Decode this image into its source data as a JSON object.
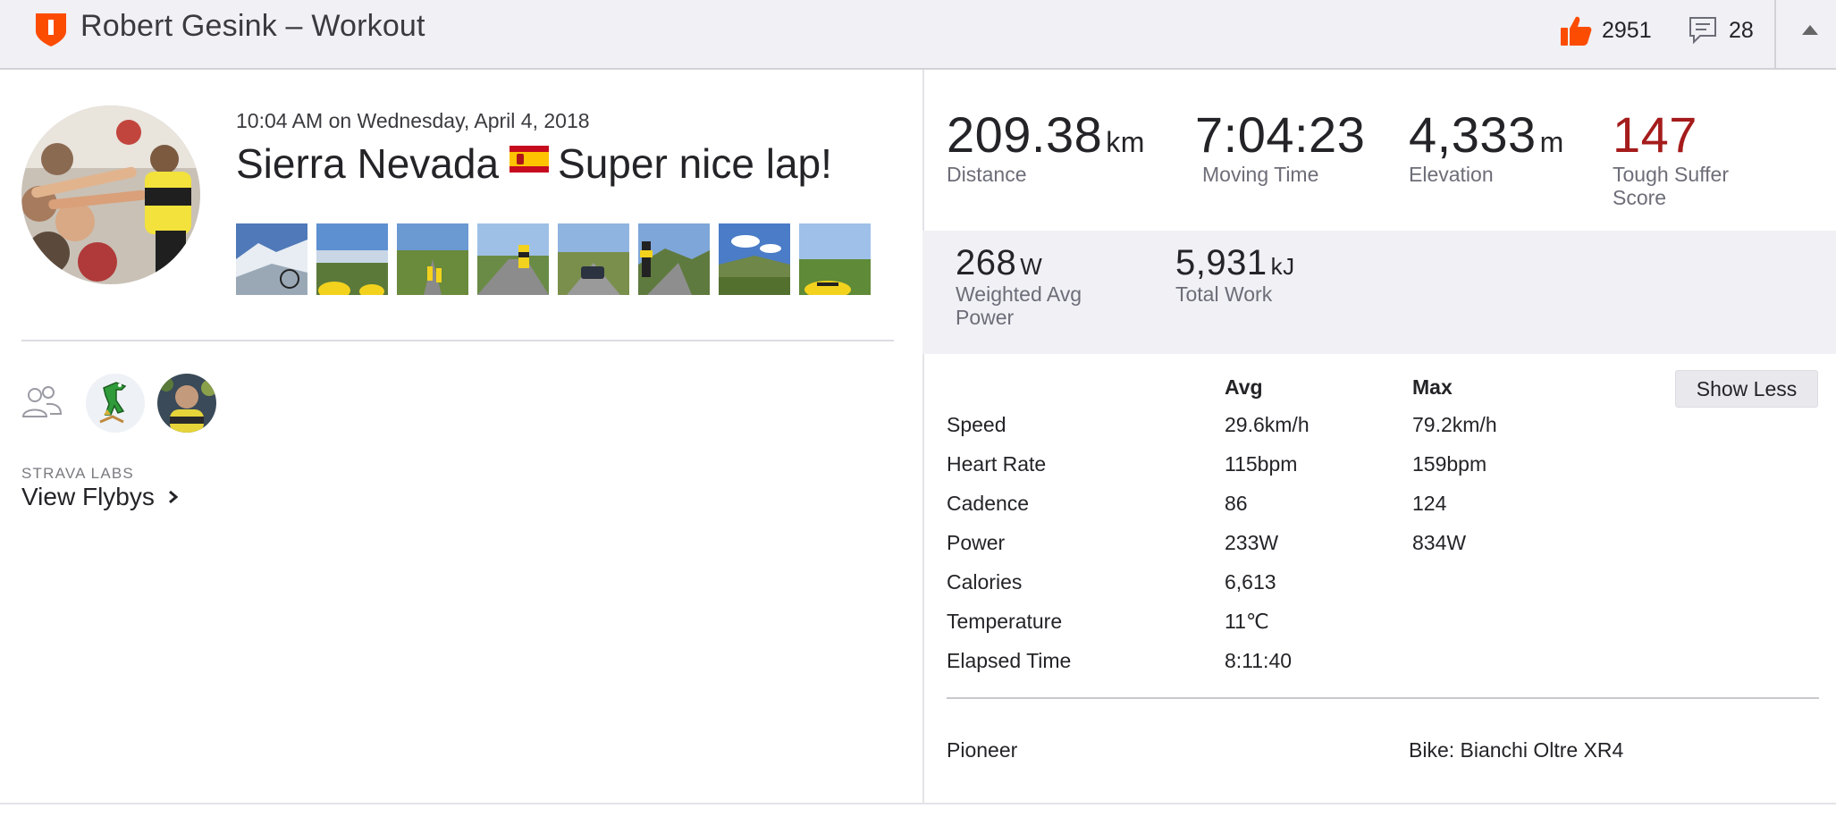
{
  "header": {
    "title": "Robert Gesink – Workout",
    "kudos_count": "2951",
    "comment_count": "28",
    "accent_color": "#fc4c02"
  },
  "activity": {
    "datetime": "10:04 AM on Wednesday, April 4, 2018",
    "name_part1": "Sierra Nevada",
    "name_part2": "Super nice lap!",
    "photo_count": 8
  },
  "social": {
    "labs_label": "STRAVA LABS",
    "flybys_label": "View Flybys"
  },
  "stats": {
    "distance": {
      "value": "209.38",
      "unit": "km",
      "label": "Distance"
    },
    "moving_time": {
      "value": "7:04:23",
      "label": "Moving Time"
    },
    "elevation": {
      "value": "4,333",
      "unit": "m",
      "label": "Elevation"
    },
    "suffer": {
      "value": "147",
      "label_line1": "Tough Suffer",
      "label_line2": "Score"
    },
    "power": {
      "value": "268",
      "unit": "W",
      "label_line1": "Weighted Avg",
      "label_line2": "Power"
    },
    "work": {
      "value": "5,931",
      "unit": "kJ",
      "label": "Total Work"
    }
  },
  "table": {
    "col_avg": "Avg",
    "col_max": "Max",
    "show_less_label": "Show Less",
    "rows": [
      {
        "label": "Speed",
        "avg": "29.6km/h",
        "max": "79.2km/h"
      },
      {
        "label": "Heart Rate",
        "avg": "115bpm",
        "max": "159bpm"
      },
      {
        "label": "Cadence",
        "avg": "86",
        "max": "124"
      },
      {
        "label": "Power",
        "avg": "233W",
        "max": "834W"
      },
      {
        "label": "Calories",
        "avg": "6,613",
        "max": ""
      },
      {
        "label": "Temperature",
        "avg": "11℃",
        "max": ""
      },
      {
        "label": "Elapsed Time",
        "avg": "8:11:40",
        "max": ""
      }
    ],
    "device": "Pioneer",
    "bike": "Bike: Bianchi Oltre XR4"
  }
}
